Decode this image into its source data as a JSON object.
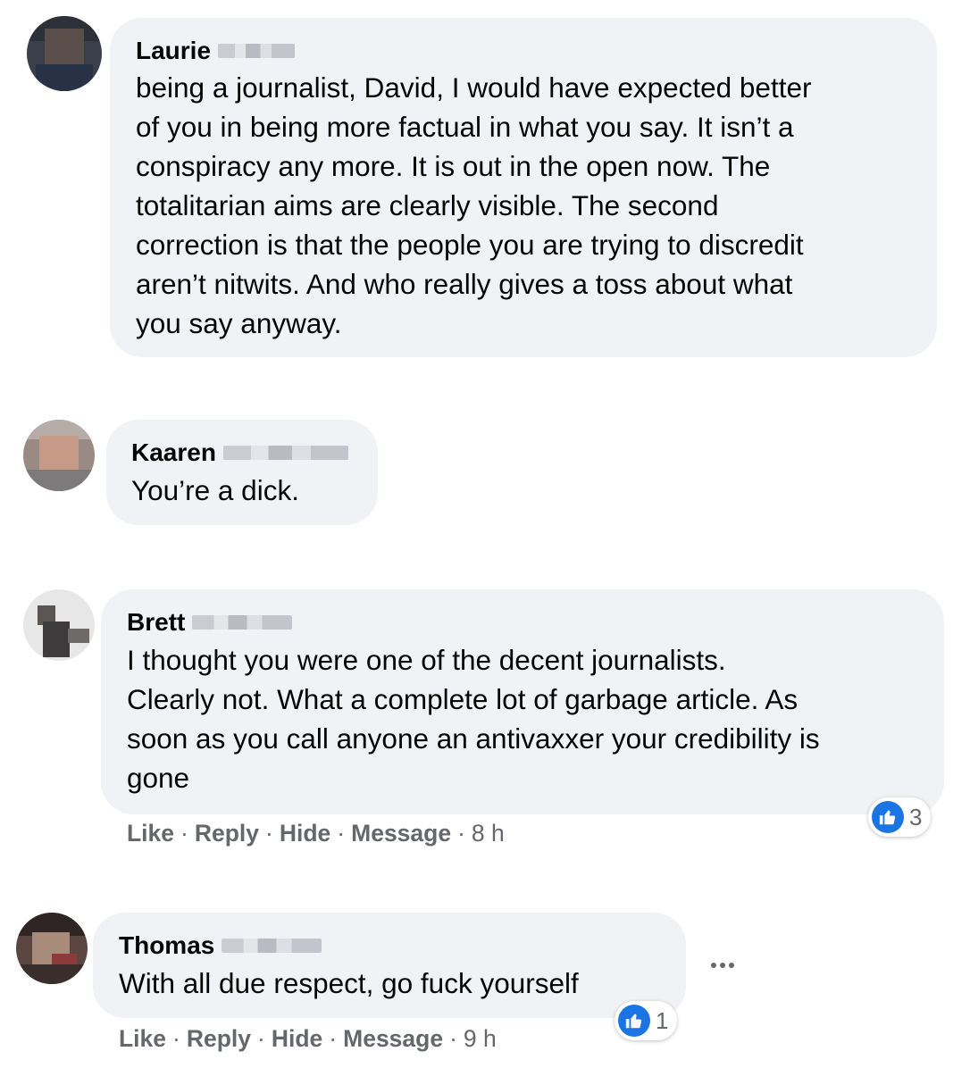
{
  "comments": [
    {
      "author": "Laurie",
      "text": "being a journalist, David, I would have expected better of you in being more factual in what you say. It isn’t a conspiracy any more. It is out in the open now. The totalitarian aims are clearly visible. The second correction is that the people you are trying to discredit aren’t nitwits. And who really gives a toss about what you say anyway.",
      "text_lines": [
        "being a journalist, David, I would have expected better",
        "of you in being more factual in what you say. It isn’t a",
        "conspiracy any more. It is out in the open now. The",
        "totalitarian aims are clearly visible. The second",
        "correction is that the people you are trying to discredit",
        "aren’t nitwits. And who really gives a toss about what",
        "you say anyway."
      ]
    },
    {
      "author": "Kaaren",
      "text_lines": [
        "You’re a dick."
      ]
    },
    {
      "author": "Brett",
      "text_lines": [
        "I thought you were one of the decent journalists.",
        "Clearly not. What a complete lot of garbage article. As",
        "soon as you call anyone an antivaxxer your credibility is",
        "gone"
      ],
      "actions": {
        "like": "Like",
        "reply": "Reply",
        "hide": "Hide",
        "message": "Message",
        "sep": "·",
        "time": "8 h"
      },
      "reaction_count": "3"
    },
    {
      "author": "Thomas",
      "text_lines": [
        "With all due respect, go fuck yourself"
      ],
      "actions": {
        "like": "Like",
        "reply": "Reply",
        "hide": "Hide",
        "message": "Message",
        "sep": "·",
        "time": "9 h"
      },
      "reaction_count": "1"
    }
  ],
  "colors": {
    "bubble": "#f0f2f5",
    "like_blue": "#1b74e4",
    "meta_gray": "#65676b"
  },
  "icons": {
    "reaction": "like-icon",
    "more": "more-options-icon"
  }
}
